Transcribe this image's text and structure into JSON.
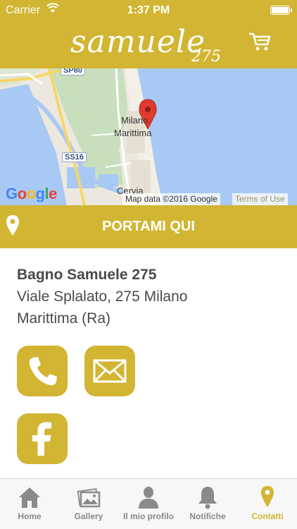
{
  "status_bar": {
    "carrier": "Carrier",
    "time": "1:37 PM"
  },
  "header": {
    "logo_word": "samuele",
    "logo_number": "275",
    "cart_icon": "shopping-cart-icon"
  },
  "map": {
    "labels": {
      "road_sp80": "SP80",
      "road_ss16": "SS16",
      "town_1": "Milano",
      "town_2": "Marittima",
      "town_3": "Cervia"
    },
    "google_logo": "Google",
    "attribution": "Map data ©2016 Google",
    "terms": "Terms of Use",
    "marker_icon": "map-pin-icon"
  },
  "directions": {
    "label": "PORTAMI QUI",
    "icon": "location-pin-icon"
  },
  "place": {
    "name": "Bagno Samuele 275",
    "address_line1": "Viale Splalato, 275 Milano",
    "address_line2": "Marittima (Ra)"
  },
  "actions": {
    "phone_icon": "phone-icon",
    "email_icon": "mail-icon",
    "facebook_icon": "facebook-icon"
  },
  "tabbar": {
    "tabs": [
      {
        "label": "Home",
        "icon": "home-icon"
      },
      {
        "label": "Gallery",
        "icon": "gallery-icon"
      },
      {
        "label": "Il mio profilo",
        "icon": "profile-icon"
      },
      {
        "label": "Notifiche",
        "icon": "bell-icon"
      },
      {
        "label": "Contatti",
        "icon": "location-pin-icon"
      }
    ],
    "active_index": 4
  },
  "colors": {
    "accent": "#d2b532",
    "text": "#4a4a4a",
    "tab_inactive": "#888888",
    "sea": "#a9c9f5"
  }
}
